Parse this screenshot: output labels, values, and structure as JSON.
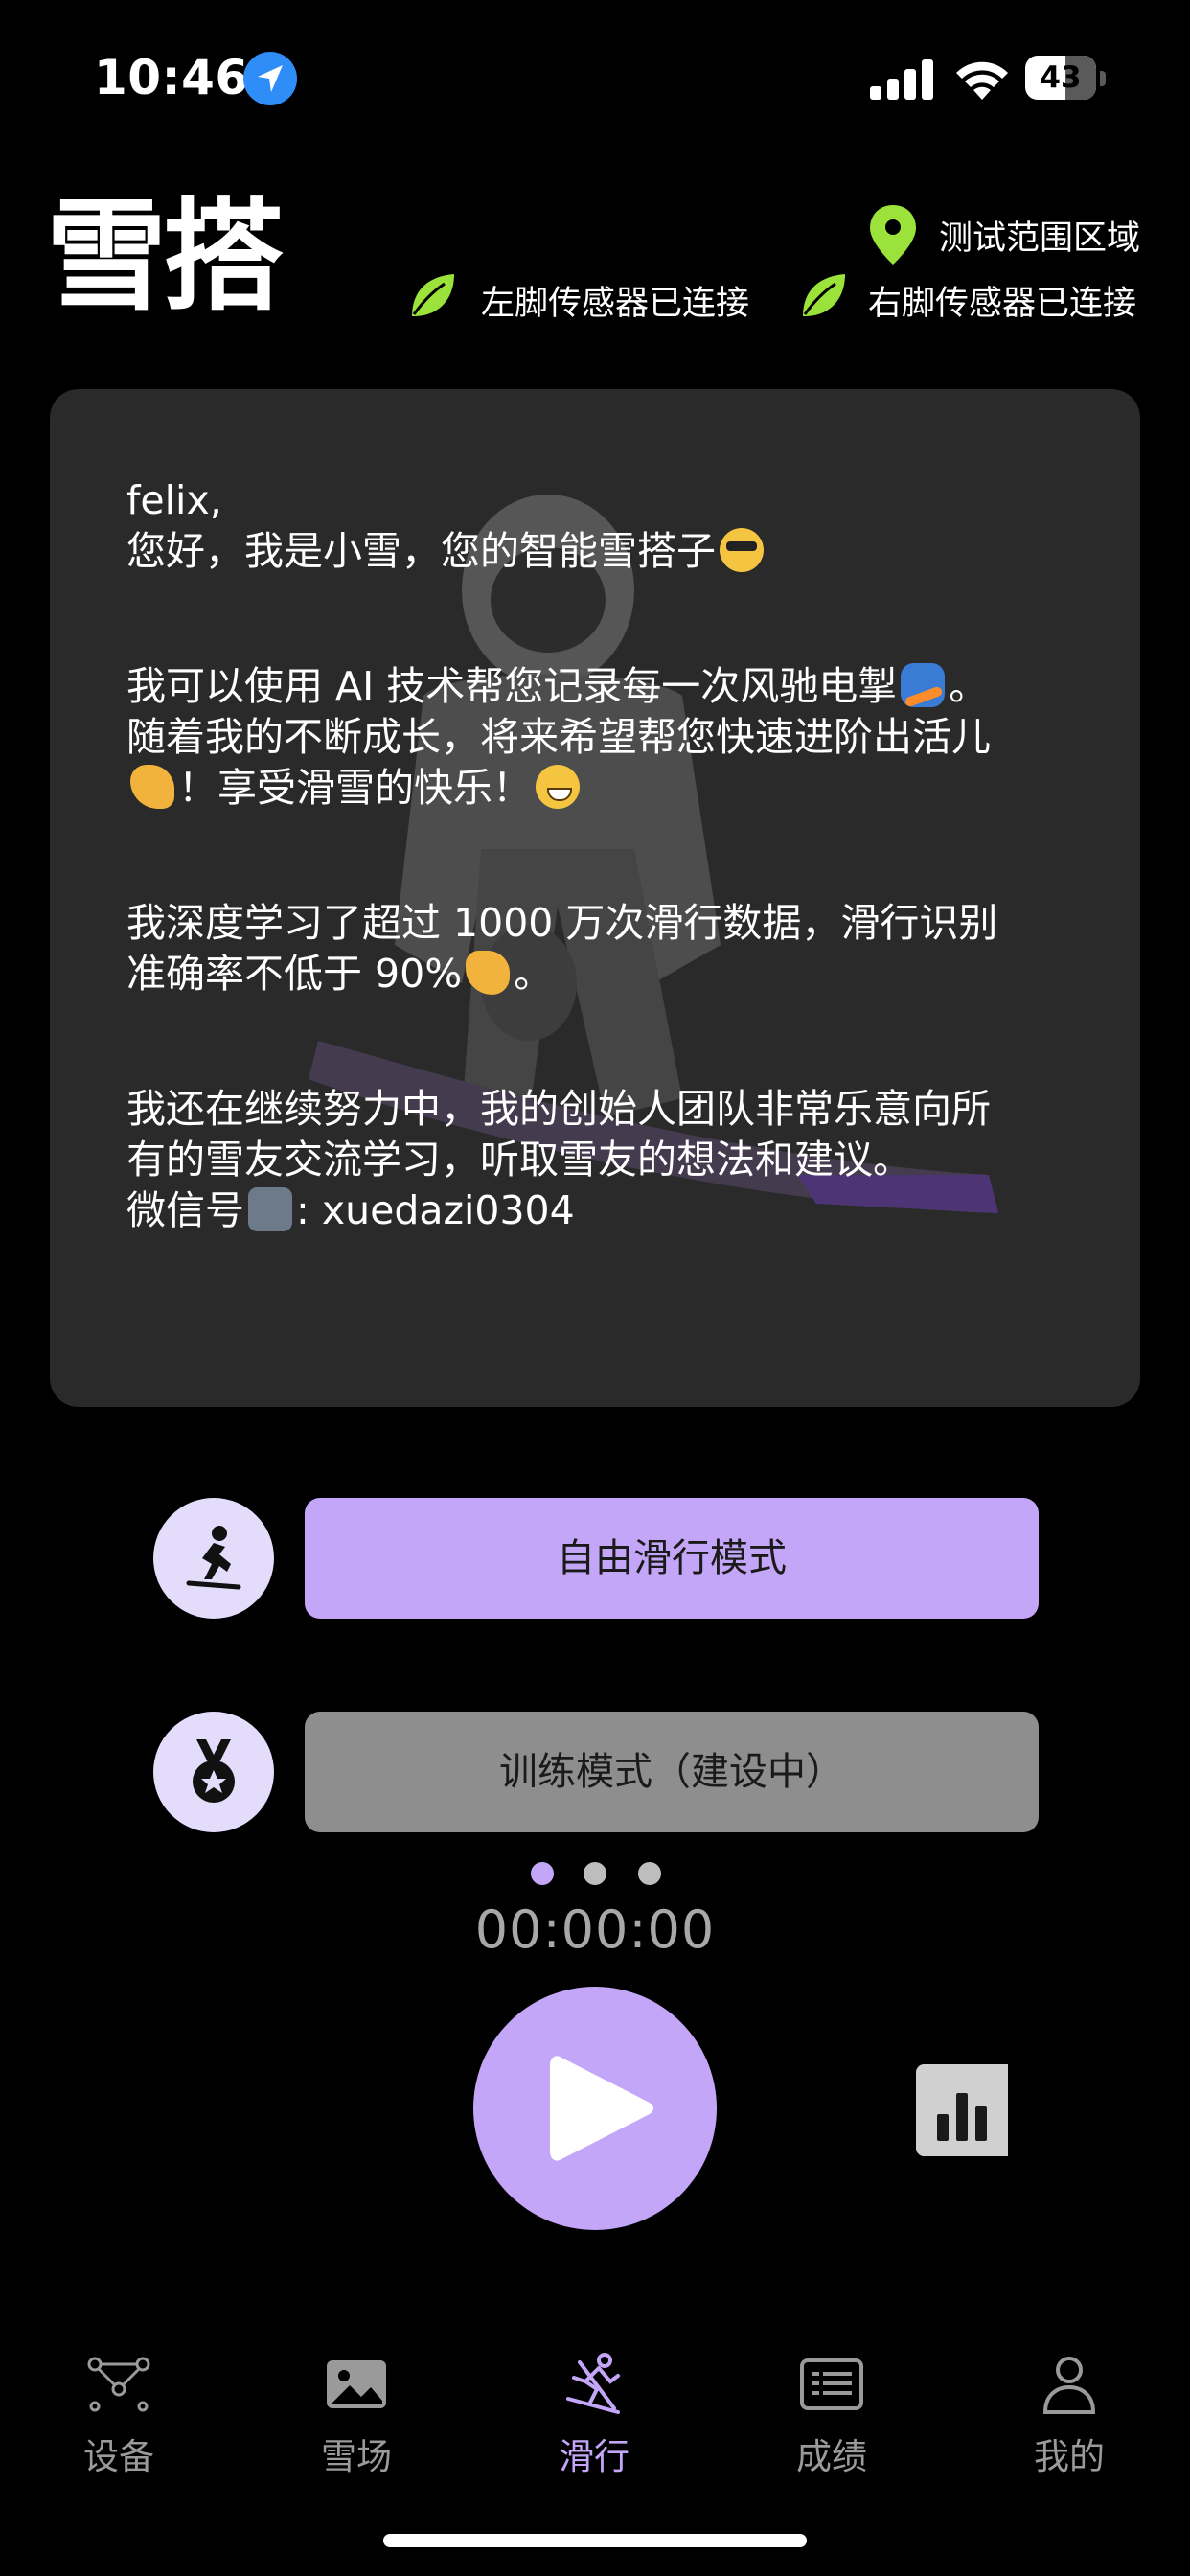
{
  "status_bar": {
    "time": "10:46",
    "battery": "43"
  },
  "header": {
    "app_name": "雪搭",
    "region": "测试范围区域",
    "left_sensor": "左脚传感器已连接",
    "right_sensor": "右脚传感器已连接"
  },
  "intro_card": {
    "greeting_name": "felix,",
    "greeting": "您好，我是小雪，您的智能雪搭子",
    "p1_a": "我可以使用 AI 技术帮您记录每一次风驰电掣",
    "p1_b": "。",
    "p1_c": "随着我的不断成长，将来希望帮您快速进阶出活儿",
    "p1_d": "！享受滑雪的快乐！",
    "p2_a": "我深度学习了超过 1000 万次滑行数据，滑行识别",
    "p2_b": "准确率不低于 90%",
    "p2_c": "。",
    "p3_a": "我还在继续努力中，我的创始人团队非常乐意向所",
    "p3_b": "有的雪友交流学习，听取雪友的想法和建议。",
    "p3_c": "微信号",
    "p3_d": ": xuedazi0304"
  },
  "modes": {
    "free_ride": "自由滑行模式",
    "training": "训练模式（建设中）"
  },
  "timer": "00:00:00",
  "tabs": [
    {
      "label": "设备",
      "icon": "device-nodes-icon"
    },
    {
      "label": "雪场",
      "icon": "image-icon"
    },
    {
      "label": "滑行",
      "icon": "skier-icon",
      "active": true
    },
    {
      "label": "成绩",
      "icon": "list-card-icon"
    },
    {
      "label": "我的",
      "icon": "person-icon"
    }
  ],
  "colors": {
    "accent": "#c3a6f7",
    "card_bg": "#2a2a2a",
    "leaf": "#9be23a",
    "pin": "#9be23a"
  }
}
